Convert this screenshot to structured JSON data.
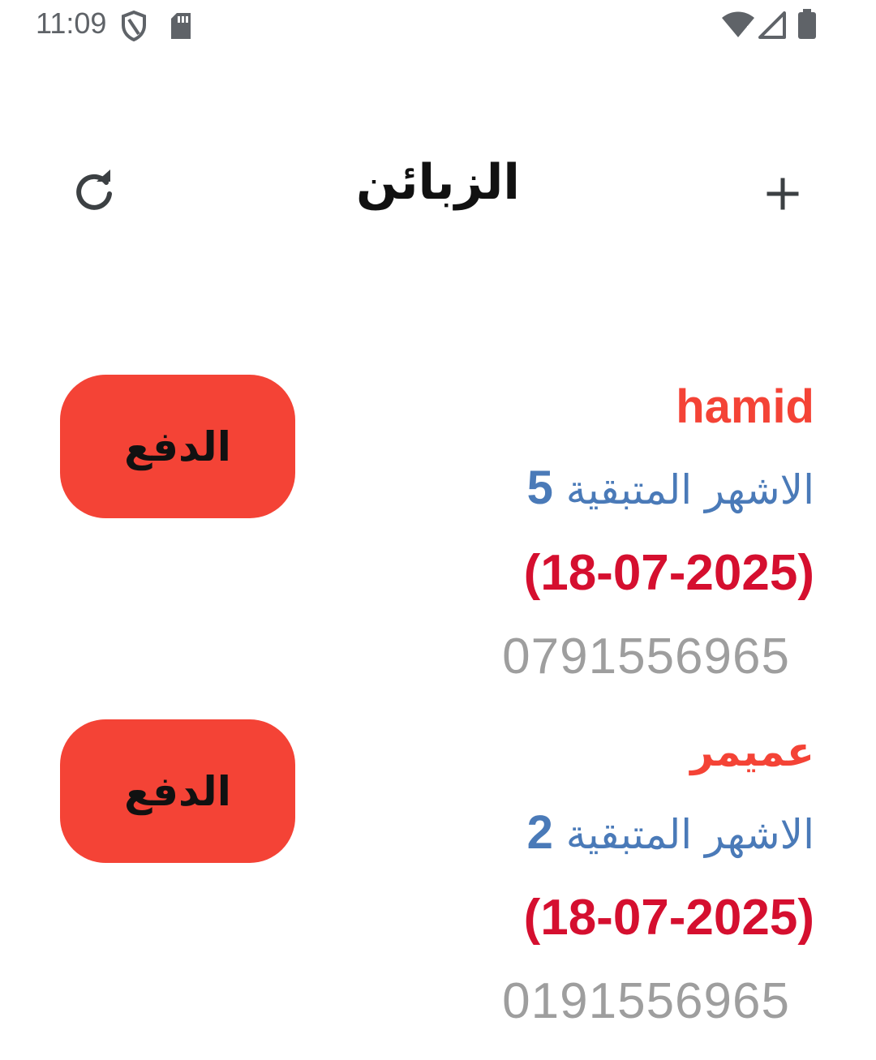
{
  "status_bar": {
    "time": "11:09",
    "left_icons": [
      "shield-icon",
      "sd-card-icon"
    ],
    "right_icons": [
      "wifi-icon",
      "signal-icon",
      "battery-icon"
    ]
  },
  "app_bar": {
    "title": "الزبائن",
    "refresh_icon": "refresh-icon",
    "add_icon": "plus-icon"
  },
  "customers": [
    {
      "name": "hamid",
      "months_label": "الاشهر المتبقية",
      "months_remaining": "5",
      "due_date": "(18-07-2025)",
      "phone": "0791556965",
      "pay_label": "الدفع"
    },
    {
      "name": "عميمر",
      "months_label": "الاشهر المتبقية",
      "months_remaining": "2",
      "due_date": "(18-07-2025)",
      "phone": "0191556965",
      "pay_label": "الدفع"
    }
  ],
  "colors": {
    "accent": "#f44336",
    "name": "#f44336",
    "months": "#4a7ab8",
    "date": "#d50f2f",
    "phone": "#9e9e9e"
  }
}
